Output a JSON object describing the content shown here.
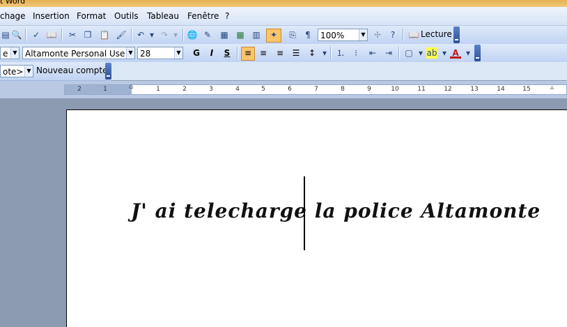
{
  "window": {
    "title": "t Word"
  },
  "menu": [
    "chage",
    "Insertion",
    "Format",
    "Outils",
    "Tableau",
    "Fenêtre",
    "?"
  ],
  "toolbar_standard": {
    "zoom": "100%",
    "reading_button": "Lecture"
  },
  "toolbar_format": {
    "style": "e P",
    "font": "Altamonte Personal Use",
    "size": "28",
    "bold": "G",
    "italic": "I",
    "underline": "S"
  },
  "toolbar_mail": {
    "account_select": "ote>",
    "new_account": "Nouveau compte"
  },
  "ruler": {
    "numbers": [
      "2",
      "1",
      "1",
      "2",
      "3",
      "4",
      "5",
      "6",
      "7",
      "8",
      "9",
      "10",
      "11",
      "12",
      "13",
      "14",
      "15"
    ]
  },
  "document": {
    "text": "J' ai telecharge la police Altamonte"
  }
}
